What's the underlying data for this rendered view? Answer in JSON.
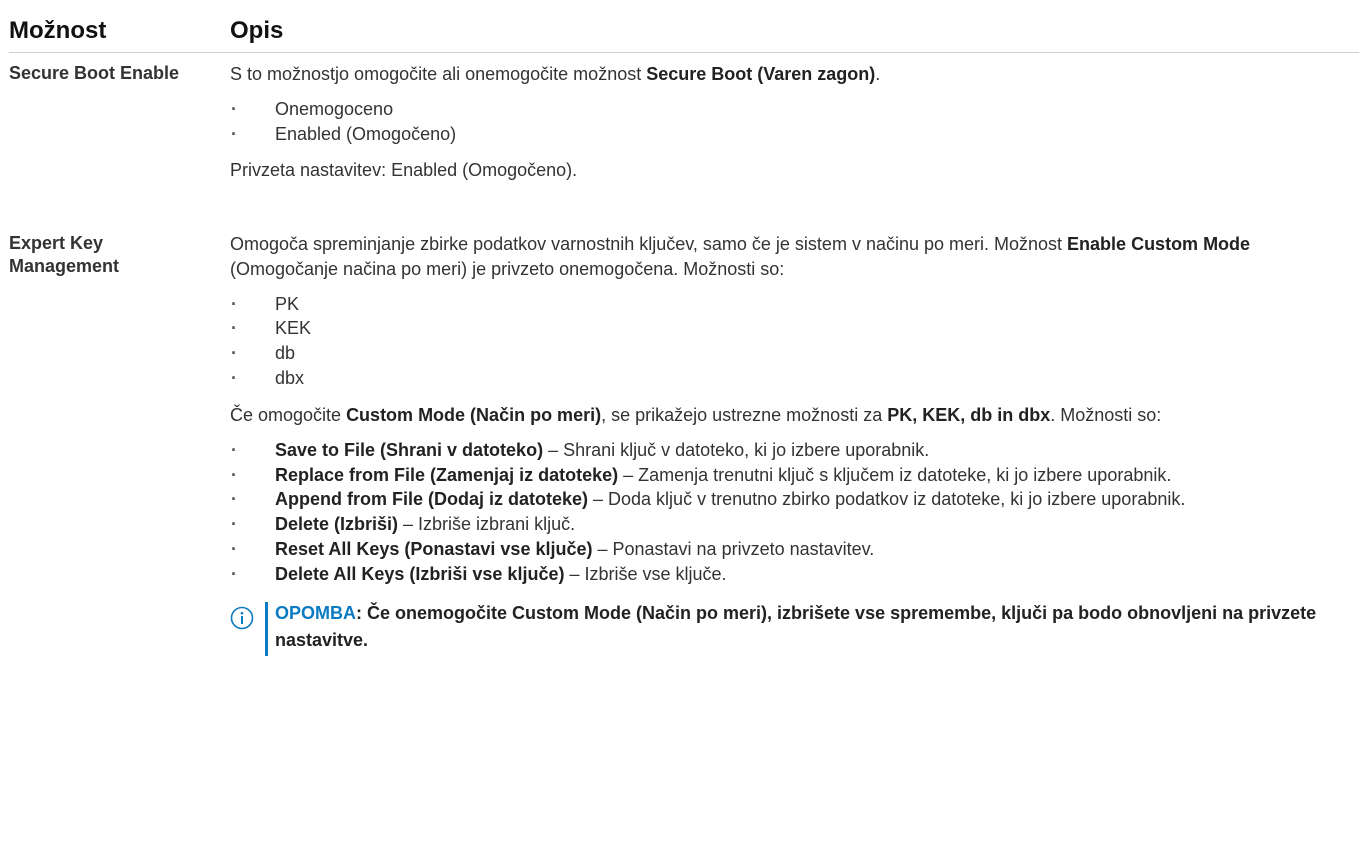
{
  "header": {
    "col1": "Možnost",
    "col2": "Opis"
  },
  "rows": [
    {
      "name": "Secure Boot Enable",
      "intro_pre": "S to možnostjo omogočite ali onemogočite možnost ",
      "intro_bold": "Secure Boot (Varen zagon)",
      "intro_post": ".",
      "items": [
        "Onemogoceno",
        "Enabled (Omogočeno)"
      ],
      "default": "Privzeta nastavitev: Enabled (Omogočeno)."
    },
    {
      "name": "Expert Key Management",
      "p1_pre": "Omogoča spreminjanje zbirke podatkov varnostnih ključev, samo če je sistem v načinu po meri. Možnost ",
      "p1_bold": "Enable Custom Mode",
      "p1_post": " (Omogočanje načina po meri) je privzeto onemogočena. Možnosti so:",
      "keys": [
        "PK",
        "KEK",
        "db",
        "dbx"
      ],
      "p2_pre": "Če omogočite ",
      "p2_bold1": "Custom Mode (Način po meri)",
      "p2_mid": ", se prikažejo ustrezne možnosti za ",
      "p2_bold2": "PK, KEK, db in dbx",
      "p2_post": ". Možnosti so:",
      "actions": [
        {
          "label": "Save to File (Shrani v datoteko)",
          "desc": " – Shrani ključ v datoteko, ki jo izbere uporabnik."
        },
        {
          "label": "Replace from File (Zamenjaj iz datoteke)",
          "desc": " – Zamenja trenutni ključ s ključem iz datoteke, ki jo izbere uporabnik."
        },
        {
          "label": "Append from File (Dodaj iz datoteke)",
          "desc": " – Doda ključ v trenutno zbirko podatkov iz datoteke, ki jo izbere uporabnik."
        },
        {
          "label": "Delete (Izbriši)",
          "desc": " – Izbriše izbrani ključ."
        },
        {
          "label": "Reset All Keys (Ponastavi vse ključe)",
          "desc": " – Ponastavi na privzeto nastavitev."
        },
        {
          "label": "Delete All Keys (Izbriši vse ključe)",
          "desc": " – Izbriše vse ključe."
        }
      ],
      "note_label": "OPOMBA",
      "note_text": ": Če onemogočite Custom Mode (Način po meri), izbrišete vse spremembe, ključi pa bodo obnovljeni na privzete nastavitve.",
      "note_icon": "info-icon"
    }
  ],
  "colors": {
    "note_accent": "#0b7bc1",
    "text": "#333333"
  }
}
